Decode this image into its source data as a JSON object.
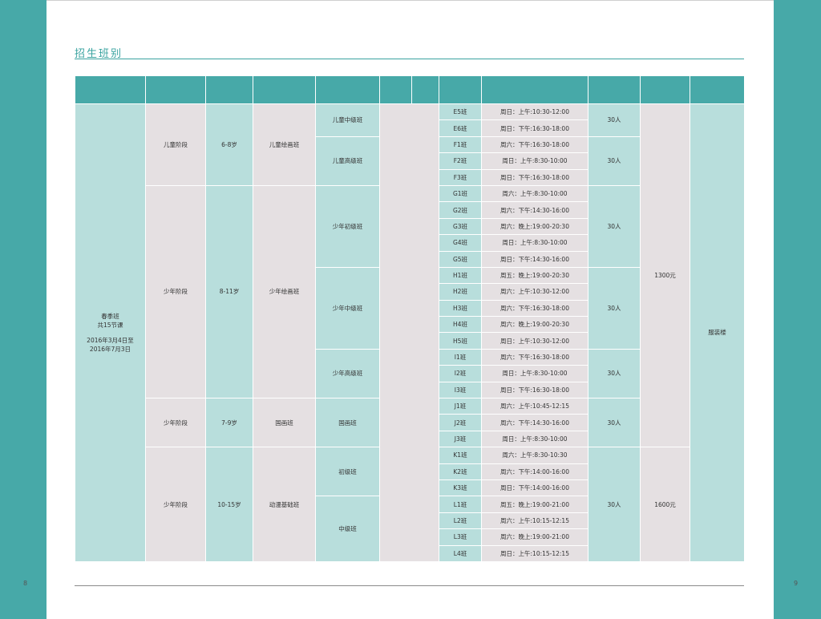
{
  "page": {
    "title": "招生班别",
    "page_left": "8",
    "page_right": "9"
  },
  "season": {
    "name": "春季班",
    "lessons": "共15节课",
    "dates_line1": "2016年3月4日至",
    "dates_line2": "2016年7月3日"
  },
  "venue": "服装楼",
  "prices": {
    "p1": "1300元",
    "p2": "1600元"
  },
  "stages": {
    "s1": {
      "stage": "儿童阶段",
      "age": "6-8岁",
      "course": "儿童绘画班"
    },
    "s2": {
      "stage": "少年阶段",
      "age": "8-11岁",
      "course": "少年绘画班"
    },
    "s3": {
      "stage": "少年阶段",
      "age": "7-9岁",
      "course": "国画班"
    },
    "s4": {
      "stage": "少年阶段",
      "age": "10-15岁",
      "course": "动漫基础班"
    }
  },
  "levels": {
    "l1": "儿童中级班",
    "l2": "儿童高级班",
    "l3": "少年初级班",
    "l4": "少年中级班",
    "l5": "少年高级班",
    "l6": "国画班",
    "l7": "初级班",
    "l8": "中级班"
  },
  "capacity": {
    "c1": "30人",
    "c2": "30人",
    "c3": "30人",
    "c4": "30人",
    "c5": "30人",
    "c6": "30人",
    "c7": "30人"
  },
  "rows": [
    {
      "class": "E5班",
      "time": "周日：上午:10:30-12:00"
    },
    {
      "class": "E6班",
      "time": "周日：下午:16:30-18:00"
    },
    {
      "class": "F1班",
      "time": "周六：下午:16:30-18:00"
    },
    {
      "class": "F2班",
      "time": "周日：上午:8:30-10:00"
    },
    {
      "class": "F3班",
      "time": "周日：下午:16:30-18:00"
    },
    {
      "class": "G1班",
      "time": "周六：上午:8:30-10:00"
    },
    {
      "class": "G2班",
      "time": "周六：下午:14:30-16:00"
    },
    {
      "class": "G3班",
      "time": "周六：晚上:19:00-20:30"
    },
    {
      "class": "G4班",
      "time": "周日：上午:8:30-10:00"
    },
    {
      "class": "G5班",
      "time": "周日：下午:14:30-16:00"
    },
    {
      "class": "H1班",
      "time": "周五：晚上:19:00-20:30"
    },
    {
      "class": "H2班",
      "time": "周六：上午:10:30-12:00"
    },
    {
      "class": "H3班",
      "time": "周六：下午:16:30-18:00"
    },
    {
      "class": "H4班",
      "time": "周六：晚上:19:00-20:30"
    },
    {
      "class": "H5班",
      "time": "周日：上午:10:30-12:00"
    },
    {
      "class": "I1班",
      "time": "周六：下午:16:30-18:00"
    },
    {
      "class": "I2班",
      "time": "周日：上午:8:30-10:00"
    },
    {
      "class": "I3班",
      "time": "周日：下午:16:30-18:00"
    },
    {
      "class": "J1班",
      "time": "周六：上午:10:45-12:15"
    },
    {
      "class": "J2班",
      "time": "周六：下午:14:30-16:00"
    },
    {
      "class": "J3班",
      "time": "周日：上午:8:30-10:00"
    },
    {
      "class": "K1班",
      "time": "周六：上午:8:30-10:30"
    },
    {
      "class": "K2班",
      "time": "周六：下午:14:00-16:00"
    },
    {
      "class": "K3班",
      "time": "周日：下午:14:00-16:00"
    },
    {
      "class": "L1班",
      "time": "周五：晚上:19:00-21:00"
    },
    {
      "class": "L2班",
      "time": "周六：上午:10:15-12:15"
    },
    {
      "class": "L3班",
      "time": "周六：晚上:19:00-21:00"
    },
    {
      "class": "L4班",
      "time": "周日：上午:10:15-12:15"
    }
  ],
  "colors": {
    "teal": "#47a9a8",
    "light_teal": "#b8dedc",
    "light_gray": "#e5e0e2",
    "title": "#3aa3a0"
  }
}
